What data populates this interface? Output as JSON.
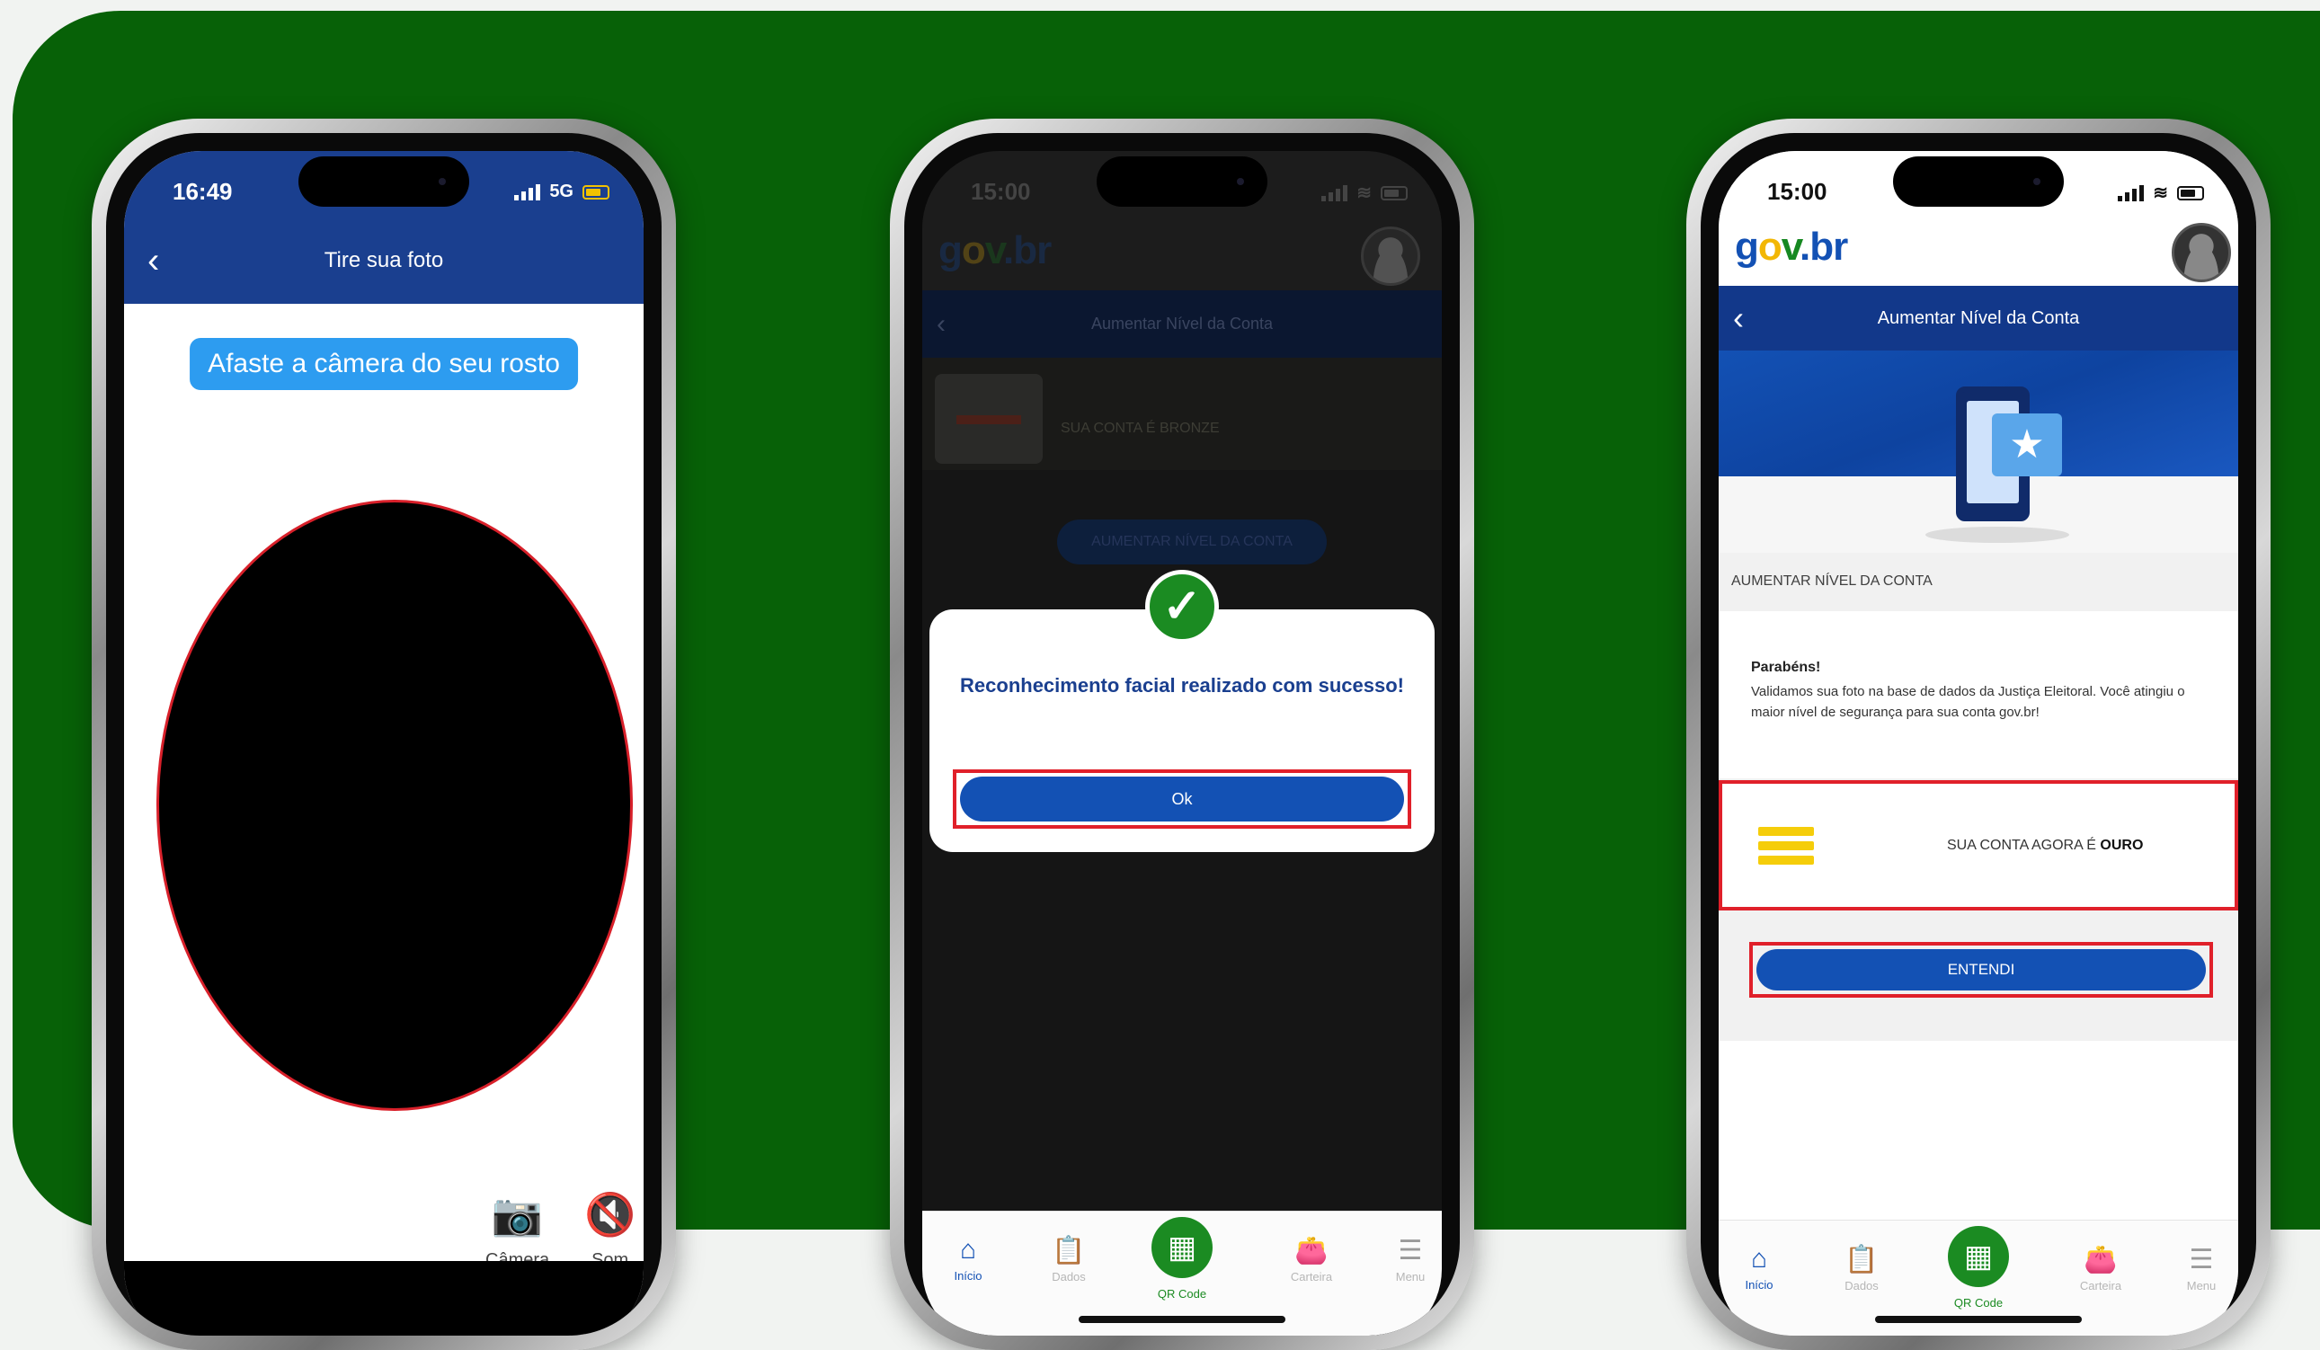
{
  "phone1": {
    "status_time": "16:49",
    "status_network": "5G",
    "header_title": "Tire sua foto",
    "instruction": "Afaste a câmera do seu rosto",
    "controls": [
      {
        "label": "Câmera",
        "icon": "camera-switch-icon"
      },
      {
        "label": "Som",
        "icon": "sound-off-icon"
      }
    ]
  },
  "phone2": {
    "status_time": "15:00",
    "logo": {
      "g": "g",
      "o": "o",
      "v": "v",
      "b": ".br"
    },
    "nav_title": "Aumentar Nível da Conta",
    "account_text": "SUA CONTA É BRONZE",
    "increase_button": "AUMENTAR NÍVEL DA CONTA",
    "dialog_message": "Reconhecimento facial realizado com sucesso!",
    "dialog_button": "Ok"
  },
  "phone3": {
    "status_time": "15:00",
    "logo": {
      "g": "g",
      "o": "o",
      "v": "v",
      "b": ".br"
    },
    "nav_title": "Aumentar Nível da Conta",
    "section_label": "AUMENTAR NÍVEL DA CONTA",
    "congrats_title": "Parabéns!",
    "congrats_text": "Validamos sua foto na base de dados da Justiça Eleitoral. Você atingiu o maior nível de segurança para sua conta gov.br!",
    "level_text_prefix": "SUA CONTA AGORA É ",
    "level_name": "OURO",
    "entendi_button": "ENTENDI"
  },
  "tabbar": [
    {
      "label": "Início",
      "icon": "home-icon"
    },
    {
      "label": "Dados",
      "icon": "clipboard-icon"
    },
    {
      "label": "QR Code",
      "icon": "qr-code-icon"
    },
    {
      "label": "Carteira",
      "icon": "wallet-icon"
    },
    {
      "label": "Menu",
      "icon": "menu-icon"
    }
  ],
  "colors": {
    "background_green": "#076107",
    "govbr_blue": "#1351b4",
    "header_blue": "#1a3f8f",
    "highlight_red": "#e0202a",
    "success_green": "#1b8b22",
    "gold": "#f5cd0a"
  }
}
